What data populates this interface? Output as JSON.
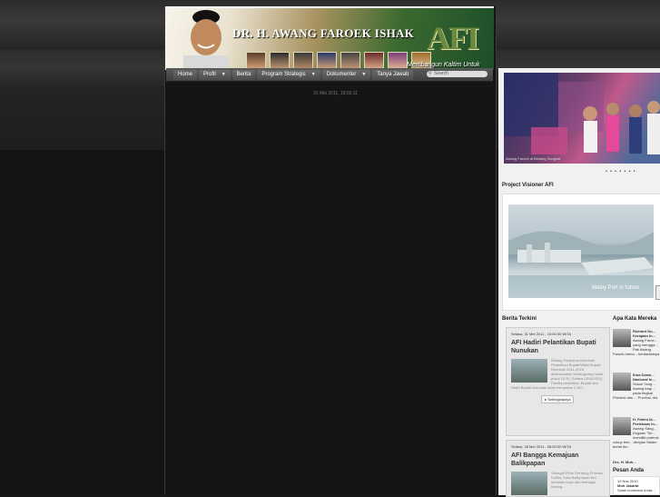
{
  "header": {
    "title": "DR. H. AWANG FAROEK ISHAK",
    "logo": "AFI",
    "tagline": "Membangun Kaltim Untuk Semua"
  },
  "nav": {
    "items": [
      {
        "label": "Home",
        "dropdown": false
      },
      {
        "label": "Profil",
        "dropdown": true
      },
      {
        "label": "Berita",
        "dropdown": false
      },
      {
        "label": "Program Strategis",
        "dropdown": true
      },
      {
        "label": "Dokumenter",
        "dropdown": true
      },
      {
        "label": "Tanya Jawab",
        "dropdown": false
      }
    ],
    "search_placeholder": "Search"
  },
  "datetime": "31 Mei 2011, 18:02:11",
  "slider": {
    "caption": "Awang Faroek di Bintang Sangkar",
    "dots": "• • • • • • •"
  },
  "project_visioner": {
    "title": "Project Visioner AFI",
    "caption": "Maloy Port in future"
  },
  "berita_terkini": {
    "title": "Berita Terkini",
    "items": [
      {
        "date": "Selasa, 31 Mei 2011 - 10:00:00 WITA",
        "title": "AFI Hadiri Pelantikan Bupati Nunukan",
        "excerpt": "Sidang Paripurna Istimewa Pelantikan Bupati/Wakil Bupati Nunukan 2011-2016 dilaksanakan berlangsung mulai pukul 10.30, Selasa (31/5/2011). Panitia pelantikan Bupati dan Wakil Bupati Nunukan telah menyebar 2.347...",
        "more": "Selengkapnya"
      },
      {
        "date": "Selasa, 28 Mei 2011 - 08:00:00 WITA",
        "title": "AFI Bangga Kemajuan Balikpapan",
        "excerpt": "Sebagai Pintu Gerbang Provinsi Kaltim, Kota Balikpapan kini semakin maju dan berbagai bidang..."
      }
    ]
  },
  "apa_kata": {
    "title": "Apa Kata Mereka",
    "items": [
      {
        "name": "Richard Gu... Kerajaan In...",
        "text": "Awang Faroe... yang mengga... Pak Awang Faroek mena... berdaulatnya"
      },
      {
        "name": "Ema Dzam... Nasional In...",
        "text": "Sosok Yang ... Awang bagi ... pada tingkat Provinsi dan ... Provinsi, dia"
      },
      {
        "name": "H. Fahmi Id... Pertekaan In...",
        "text": "Awang Sang... Dugaan \"Se... memiliki potensi cukup bes... dengan Salam berlat ibu."
      },
      {
        "name": "Drs. H. Muh...",
        "text": ""
      }
    ]
  },
  "pesan_anda": {
    "title": "Pesan Anda",
    "date": "19 Nov 2010",
    "name": "Moh Jakarta",
    "text": "Salah komentar Anda..."
  }
}
